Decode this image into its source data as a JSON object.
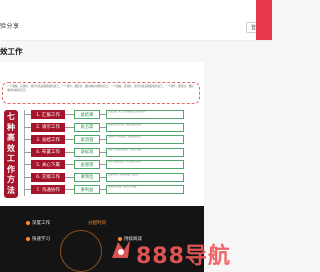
{
  "header": {
    "site_title": "验分享",
    "login_label": "登录"
  },
  "article": {
    "title": "效工作"
  },
  "infographic": {
    "intro_text": "一个领袖，首领时，领导力就是我需要的自己，一个领导，都觉过，做好事的时候的自己。一个领袖，首领时，领导力就是我需要的自己，一个领导，都觉过，做好事的时候的自己。",
    "method_title": "七种高效工作方法",
    "methods": [
      {
        "name": "1. 汇报工作",
        "tag": "说结果",
        "desc": "注意结果，把工作的结果先汇报给领导"
      },
      {
        "name": "2. 请示工作",
        "tag": "说方案",
        "desc": "说出自己的方案，请领导进行选择"
      },
      {
        "name": "3. 总结工作",
        "tag": "说流程",
        "desc": "总结每一步的流程，找出问题所在"
      },
      {
        "name": "4. 布置工作",
        "tag": "说标准",
        "desc": "讲清工作要求和标准，让执行有据"
      },
      {
        "name": "5. 关心下属",
        "tag": "说感受",
        "desc": "多问下属的感受，关心他们的需求"
      },
      {
        "name": "6. 交接工作",
        "tag": "讲到位",
        "desc": "交接时把工作讲清讲透，做到位"
      },
      {
        "name": "7. 沟通协作",
        "tag": "讲利益",
        "desc": "讲清双方利益，促进合作共赢"
      }
    ]
  },
  "dark_section": {
    "items": [
      "深度工作",
      "快速学习",
      "分配时间",
      "持续阅读"
    ]
  },
  "watermark": {
    "text": "888导航"
  }
}
